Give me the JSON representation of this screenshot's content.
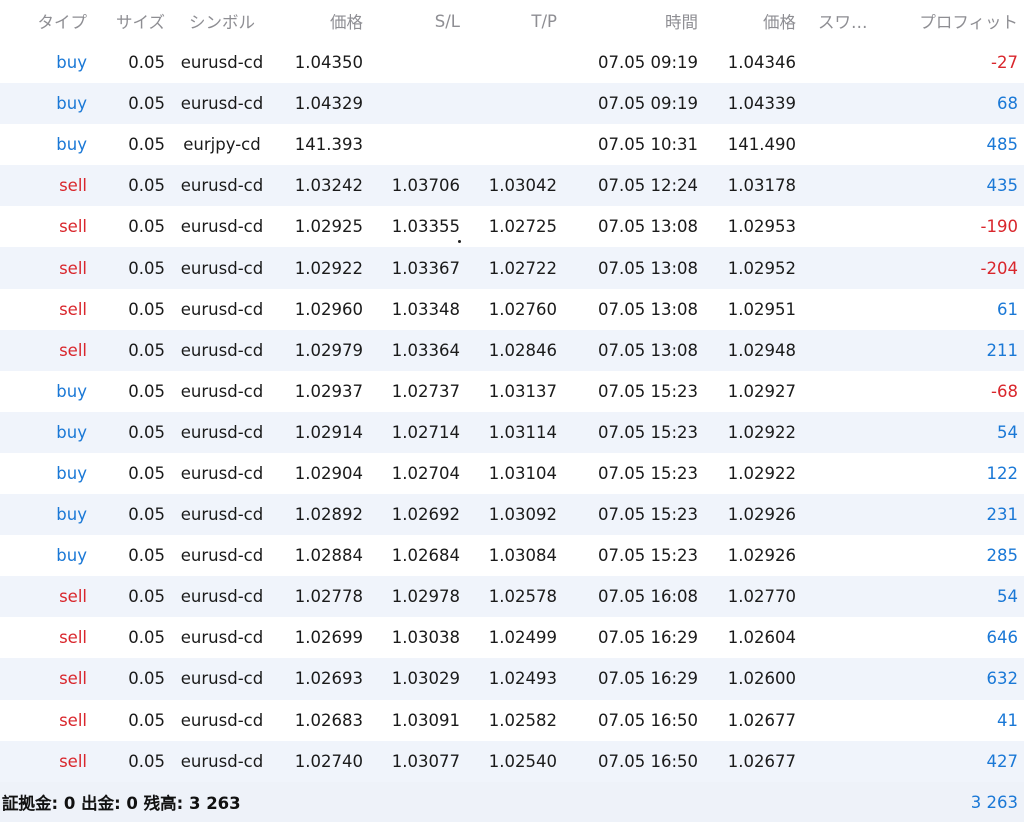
{
  "headers": {
    "type": "タイプ",
    "size": "サイズ",
    "symbol": "シンボル",
    "price": "価格",
    "sl": "S/L",
    "tp": "T/P",
    "time": "時間",
    "price2": "価格",
    "swap": "スワ…",
    "profit": "プロフィット"
  },
  "rows": [
    {
      "type": "buy",
      "size": "0.05",
      "symbol": "eurusd-cd",
      "price": "1.04350",
      "sl": "",
      "tp": "",
      "time": "07.05 09:19",
      "price2": "1.04346",
      "profit": "-27"
    },
    {
      "type": "buy",
      "size": "0.05",
      "symbol": "eurusd-cd",
      "price": "1.04329",
      "sl": "",
      "tp": "",
      "time": "07.05 09:19",
      "price2": "1.04339",
      "profit": "68"
    },
    {
      "type": "buy",
      "size": "0.05",
      "symbol": "eurjpy-cd",
      "price": "141.393",
      "sl": "",
      "tp": "",
      "time": "07.05 10:31",
      "price2": "141.490",
      "profit": "485"
    },
    {
      "type": "sell",
      "size": "0.05",
      "symbol": "eurusd-cd",
      "price": "1.03242",
      "sl": "1.03706",
      "tp": "1.03042",
      "time": "07.05 12:24",
      "price2": "1.03178",
      "profit": "435"
    },
    {
      "type": "sell",
      "size": "0.05",
      "symbol": "eurusd-cd",
      "price": "1.02925",
      "sl": "1.03355",
      "tp": "1.02725",
      "time": "07.05 13:08",
      "price2": "1.02953",
      "profit": "-190"
    },
    {
      "type": "sell",
      "size": "0.05",
      "symbol": "eurusd-cd",
      "price": "1.02922",
      "sl": "1.03367",
      "tp": "1.02722",
      "time": "07.05 13:08",
      "price2": "1.02952",
      "profit": "-204"
    },
    {
      "type": "sell",
      "size": "0.05",
      "symbol": "eurusd-cd",
      "price": "1.02960",
      "sl": "1.03348",
      "tp": "1.02760",
      "time": "07.05 13:08",
      "price2": "1.02951",
      "profit": "61"
    },
    {
      "type": "sell",
      "size": "0.05",
      "symbol": "eurusd-cd",
      "price": "1.02979",
      "sl": "1.03364",
      "tp": "1.02846",
      "time": "07.05 13:08",
      "price2": "1.02948",
      "profit": "211"
    },
    {
      "type": "buy",
      "size": "0.05",
      "symbol": "eurusd-cd",
      "price": "1.02937",
      "sl": "1.02737",
      "tp": "1.03137",
      "time": "07.05 15:23",
      "price2": "1.02927",
      "profit": "-68"
    },
    {
      "type": "buy",
      "size": "0.05",
      "symbol": "eurusd-cd",
      "price": "1.02914",
      "sl": "1.02714",
      "tp": "1.03114",
      "time": "07.05 15:23",
      "price2": "1.02922",
      "profit": "54"
    },
    {
      "type": "buy",
      "size": "0.05",
      "symbol": "eurusd-cd",
      "price": "1.02904",
      "sl": "1.02704",
      "tp": "1.03104",
      "time": "07.05 15:23",
      "price2": "1.02922",
      "profit": "122"
    },
    {
      "type": "buy",
      "size": "0.05",
      "symbol": "eurusd-cd",
      "price": "1.02892",
      "sl": "1.02692",
      "tp": "1.03092",
      "time": "07.05 15:23",
      "price2": "1.02926",
      "profit": "231"
    },
    {
      "type": "buy",
      "size": "0.05",
      "symbol": "eurusd-cd",
      "price": "1.02884",
      "sl": "1.02684",
      "tp": "1.03084",
      "time": "07.05 15:23",
      "price2": "1.02926",
      "profit": "285"
    },
    {
      "type": "sell",
      "size": "0.05",
      "symbol": "eurusd-cd",
      "price": "1.02778",
      "sl": "1.02978",
      "tp": "1.02578",
      "time": "07.05 16:08",
      "price2": "1.02770",
      "profit": "54"
    },
    {
      "type": "sell",
      "size": "0.05",
      "symbol": "eurusd-cd",
      "price": "1.02699",
      "sl": "1.03038",
      "tp": "1.02499",
      "time": "07.05 16:29",
      "price2": "1.02604",
      "profit": "646"
    },
    {
      "type": "sell",
      "size": "0.05",
      "symbol": "eurusd-cd",
      "price": "1.02693",
      "sl": "1.03029",
      "tp": "1.02493",
      "time": "07.05 16:29",
      "price2": "1.02600",
      "profit": "632"
    },
    {
      "type": "sell",
      "size": "0.05",
      "symbol": "eurusd-cd",
      "price": "1.02683",
      "sl": "1.03091",
      "tp": "1.02582",
      "time": "07.05 16:50",
      "price2": "1.02677",
      "profit": "41"
    },
    {
      "type": "sell",
      "size": "0.05",
      "symbol": "eurusd-cd",
      "price": "1.02740",
      "sl": "1.03077",
      "tp": "1.02540",
      "time": "07.05 16:50",
      "price2": "1.02677",
      "profit": "427"
    }
  ],
  "footer": {
    "summary": "証拠金: 0 出金: 0 残高: 3 263",
    "total": "3 263"
  },
  "colors": {
    "buy": "#1a78d6",
    "sell": "#d9262c",
    "positive": "#1a78d6",
    "negative": "#d9262c",
    "header": "#8e8e93",
    "stripe": "#f0f4fb"
  }
}
